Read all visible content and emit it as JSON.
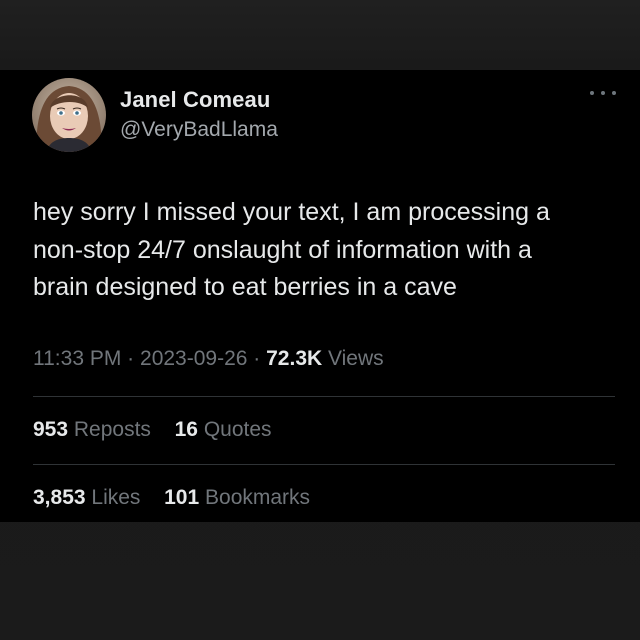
{
  "author": {
    "display_name": "Janel Comeau",
    "handle": "@VeryBadLlama"
  },
  "tweet": {
    "lines": [
      "hey sorry I missed your text, I am processing a",
      "non-stop 24/7 onslaught of information with a",
      "brain designed to eat berries in a cave"
    ]
  },
  "meta": {
    "time": "11:33 PM",
    "separator": "·",
    "date": "2023-09-26",
    "views_count": "72.3K",
    "views_label": "Views"
  },
  "stats": {
    "reposts_count": "953",
    "reposts_label": "Reposts",
    "quotes_count": "16",
    "quotes_label": "Quotes",
    "likes_count": "3,853",
    "likes_label": "Likes",
    "bookmarks_count": "101",
    "bookmarks_label": "Bookmarks"
  },
  "icons": {
    "more": "more-horizontal-icon"
  },
  "colors": {
    "card_background": "#000000",
    "page_background": "#1a1a1a",
    "primary_text": "#e7e9ea",
    "secondary_text": "#71767b",
    "divider": "#2f3336"
  }
}
